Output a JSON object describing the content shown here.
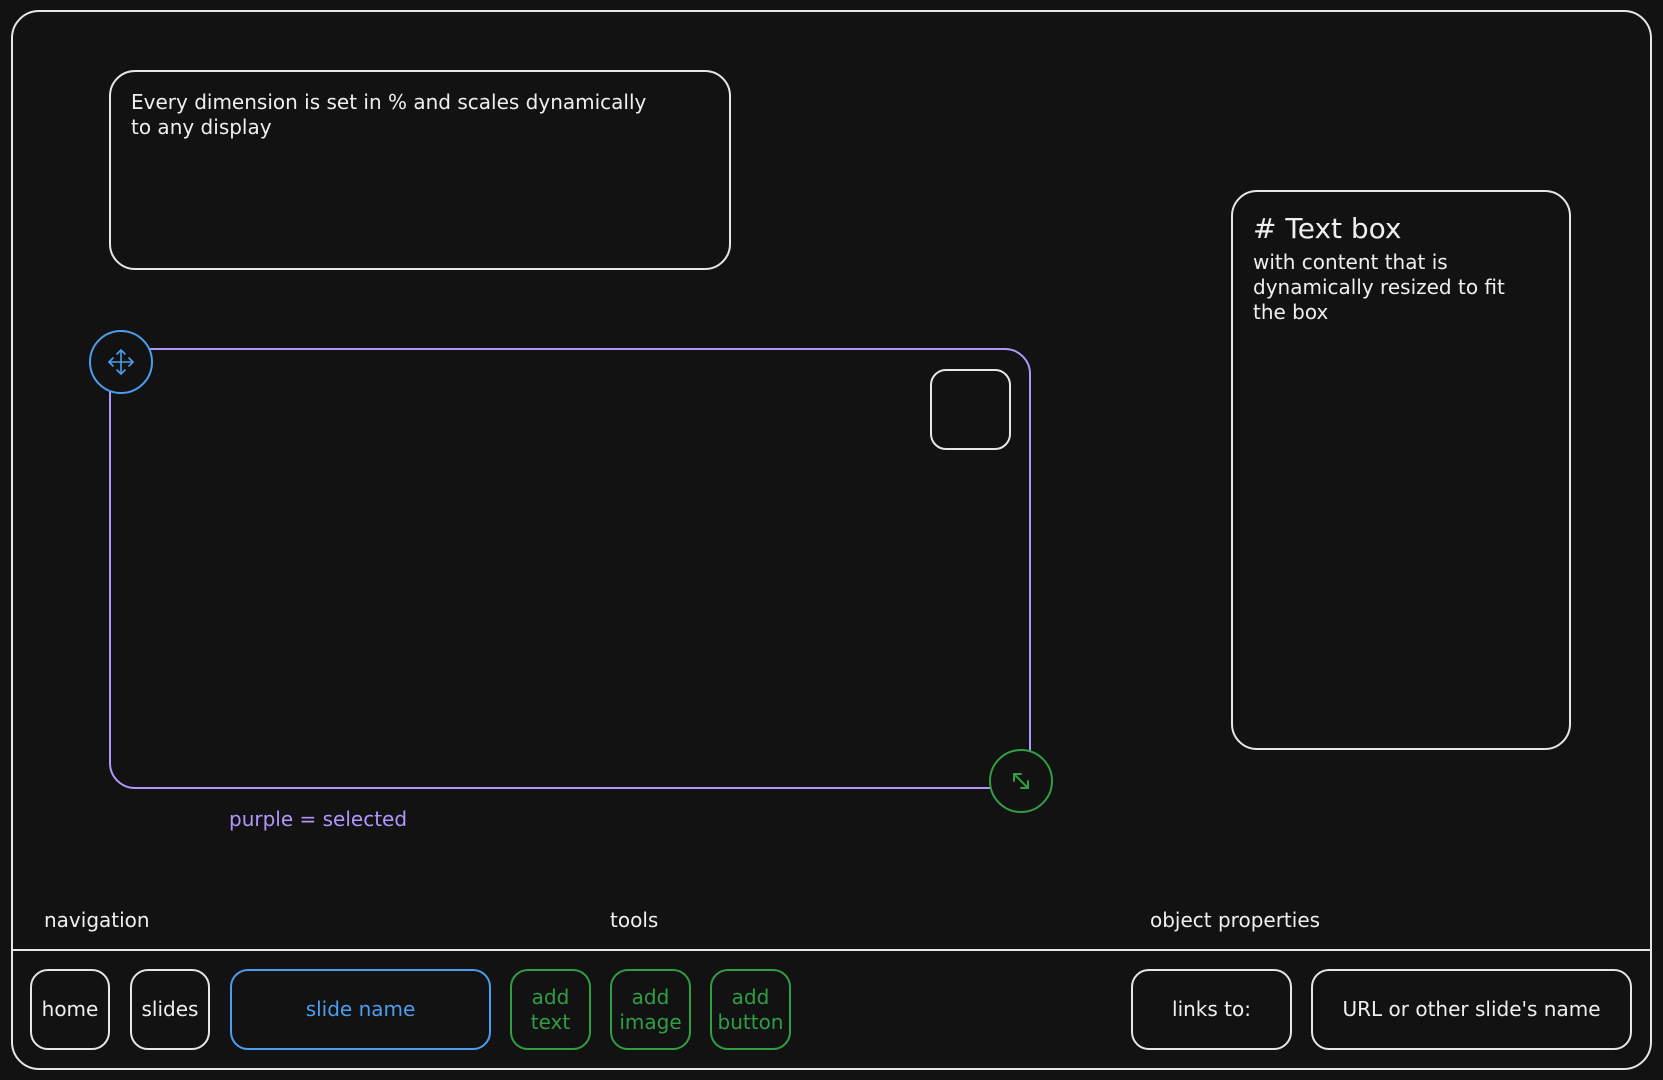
{
  "note": {
    "text": "Every dimension is set in % and scales dynamically\nto any display"
  },
  "textbox": {
    "title": "# Text box",
    "body": "with content that is\ndynamically resized to fit\nthe box"
  },
  "canvas": {
    "selected_caption": "purple = selected",
    "move_handle_icon": "move-icon",
    "resize_handle_icon": "resize-icon"
  },
  "sections": {
    "navigation": "navigation",
    "tools": "tools",
    "object_properties": "object properties"
  },
  "toolbar": {
    "home": "home",
    "slides": "slides",
    "slide_name": "slide name",
    "add_text": "add\ntext",
    "add_image": "add\nimage",
    "add_button": "add\nbutton",
    "links_to": "links to:",
    "link_target": "URL or other slide's name"
  },
  "colors": {
    "background": "#121212",
    "stroke": "#e6e6e6",
    "blue": "#4a9eed",
    "green": "#2f9e44",
    "purple": "#b197fc"
  }
}
